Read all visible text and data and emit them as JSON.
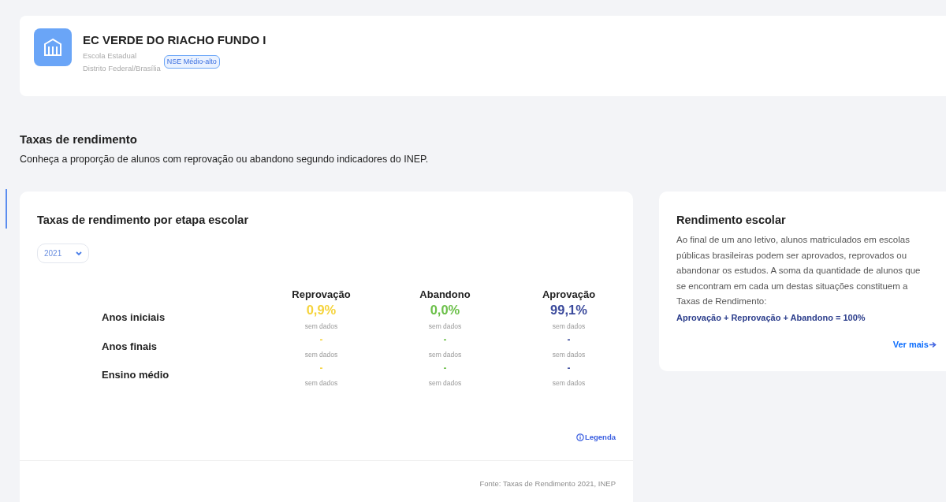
{
  "school": {
    "name": "EC VERDE DO RIACHO FUNDO I",
    "type": "Escola Estadual",
    "location": "Distrito Federal/Brasília",
    "badge": "NSE Médio-alto"
  },
  "section": {
    "title": "Taxas de rendimento",
    "subtitle": "Conheça a proporção de alunos com reprovação ou abandono segundo indicadores do INEP."
  },
  "main_card": {
    "title": "Taxas de rendimento por etapa escolar",
    "year_select": {
      "value": "2021"
    },
    "columns": [
      {
        "label": "Reprovação",
        "color": "#f5d33c"
      },
      {
        "label": "Abandono",
        "color": "#6cc04a"
      },
      {
        "label": "Aprovação",
        "color": "#3b4a9c"
      }
    ],
    "rows": [
      {
        "label": "Anos iniciais",
        "cells": [
          {
            "value": "0,9%",
            "note": "sem dados"
          },
          {
            "value": "0,0%",
            "note": "sem dados"
          },
          {
            "value": "99,1%",
            "note": "sem dados"
          }
        ]
      },
      {
        "label": "Anos finais",
        "cells": [
          {
            "value": "-",
            "note": "sem dados"
          },
          {
            "value": "-",
            "note": "sem dados"
          },
          {
            "value": "-",
            "note": "sem dados"
          }
        ]
      },
      {
        "label": "Ensino médio",
        "cells": [
          {
            "value": "-",
            "note": "sem dados"
          },
          {
            "value": "-",
            "note": "sem dados"
          },
          {
            "value": "-",
            "note": "sem dados"
          }
        ]
      }
    ],
    "legend_link": "Legenda",
    "source": "Fonte: Taxas de Rendimento 2021, INEP"
  },
  "info_card": {
    "title": "Rendimento escolar",
    "text": "Ao final de um ano letivo, alunos matriculados em escolas públicas brasileiras podem ser aprovados, reprovados ou abandonar os estudos. A soma da quantidade de alunos que se encontram em cada um destas situações constituem a Taxas de Rendimento:",
    "formula": "Aprovação + Reprovação + Abandono = 100%",
    "link": "Ver mais"
  }
}
